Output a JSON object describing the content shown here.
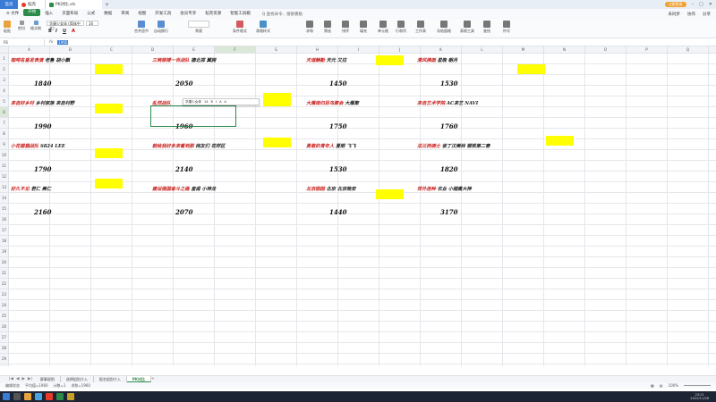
{
  "titlebar": {
    "home_tab": "首页",
    "app_tab": "稻壳",
    "doc_tab": "PK对比.xls",
    "add_tab": "+",
    "login": "立即登录",
    "win_min": "–",
    "win_max": "▢",
    "win_close": "✕"
  },
  "menubar": {
    "file": "≡ 文件",
    "items": [
      "开始",
      "插入",
      "页面布局",
      "公式",
      "数据",
      "审阅",
      "视图",
      "开发工具",
      "会员专享",
      "稻壳资源",
      "智能工具箱"
    ],
    "active_index": 0,
    "search": "Q 查找命令、搜索模板",
    "right": [
      "未同步",
      "协作",
      "分享"
    ]
  },
  "ribbon": {
    "paste": "粘贴",
    "cut": "剪切",
    "format_painter": "格式刷",
    "font_name": "华康少女体 (简体中文)",
    "font_size": "16",
    "merge": "合并居中",
    "wrap": "自动换行",
    "general": "常规",
    "cond_format": "条件格式",
    "table_style": "表格样式",
    "sum": "求和",
    "filter": "筛选",
    "sort": "排序",
    "fill": "填充",
    "cell": "单元格",
    "rowcol": "行和列",
    "worksheet": "工作表",
    "freeze": "冻结窗格",
    "table_tools": "表格工具",
    "find": "查找",
    "symbol": "符号"
  },
  "formulabar": {
    "namebox": "F6",
    "fx": "fx",
    "value": "1960"
  },
  "columns": [
    "A",
    "B",
    "C",
    "D",
    "E",
    "F",
    "G",
    "H",
    "I",
    "J",
    "K",
    "L",
    "M",
    "N",
    "O",
    "P",
    "Q",
    "R"
  ],
  "rows": [
    "1",
    "2",
    "3",
    "4",
    "5",
    "6",
    "7",
    "8",
    "9",
    "10",
    "11",
    "12",
    "13",
    "14",
    "15",
    "16",
    "17",
    "18",
    "19",
    "20",
    "21",
    "22",
    "23",
    "24",
    "25",
    "26",
    "27",
    "28",
    "29",
    "30",
    "31",
    "32",
    "33"
  ],
  "teams": [
    {
      "name": "咖啡名垂发表演",
      "members": "老鲁 胡小飘",
      "score": "1840"
    },
    {
      "name": "三两银楼一世战队",
      "members": "德北郑 翼拥",
      "score": "2050"
    },
    {
      "name": "天道酬勤",
      "members": "天元 又拉",
      "score": "1450"
    },
    {
      "name": "清风拂面",
      "members": "星晚 朝月",
      "score": "1530"
    },
    {
      "name": "来自好乡村",
      "members": "乡村家族 来自村野",
      "score": "1990"
    },
    {
      "name": "乱然战队",
      "members": "",
      "score": "1960"
    },
    {
      "name": "大雁南归百鸟聚会",
      "members": "大雁聚",
      "score": "1750"
    },
    {
      "name": "来自艺术学院",
      "members": "AC来艺 NAVI",
      "score": "1760"
    },
    {
      "name": "小花猫猫战队",
      "members": "S824 LEE",
      "score": "1790"
    },
    {
      "name": "就给我好多来看到那",
      "members": "网友们 花样区",
      "score": "2140"
    },
    {
      "name": "勇敢的青年人",
      "members": "夏眼 飞飞",
      "score": "1530"
    },
    {
      "name": "法兰西骑士",
      "members": "谈丁汉美林 钢铁第二春",
      "score": "1820"
    },
    {
      "name": "好久不见",
      "members": "君仁 美仁",
      "score": "2160"
    },
    {
      "name": "建设强国奋斗之路",
      "members": "皇甫 小神龙",
      "score": "2070"
    },
    {
      "name": "北京囡囡",
      "members": "北京 北京晚安",
      "score": "1440"
    },
    {
      "name": "郊外连种",
      "members": "农业 小烟熏大神",
      "score": "3170"
    }
  ],
  "minitoolbar": {
    "font": "华康少女体",
    "size": "14",
    "bold": "B",
    "italic": "I",
    "underline": "A",
    "fill": "A"
  },
  "sheettabs": {
    "nav": [
      "|◀",
      "◀",
      "▶",
      "▶|"
    ],
    "tabs": [
      "赛事规则",
      "选择组别介入",
      "报名组别介入",
      "PK对比"
    ],
    "active_index": 3,
    "add": "+"
  },
  "statusbar": {
    "left": [
      "编辑状态",
      "平均值=1960",
      "计数=1",
      "求和=1960"
    ],
    "zoom": "100%"
  },
  "taskbar": {
    "time": "23:21",
    "date": "2022/11/26"
  },
  "colors": {
    "accent": "#2c8a4a",
    "team_name": "#c8201e",
    "highlight": "#ffff00"
  }
}
